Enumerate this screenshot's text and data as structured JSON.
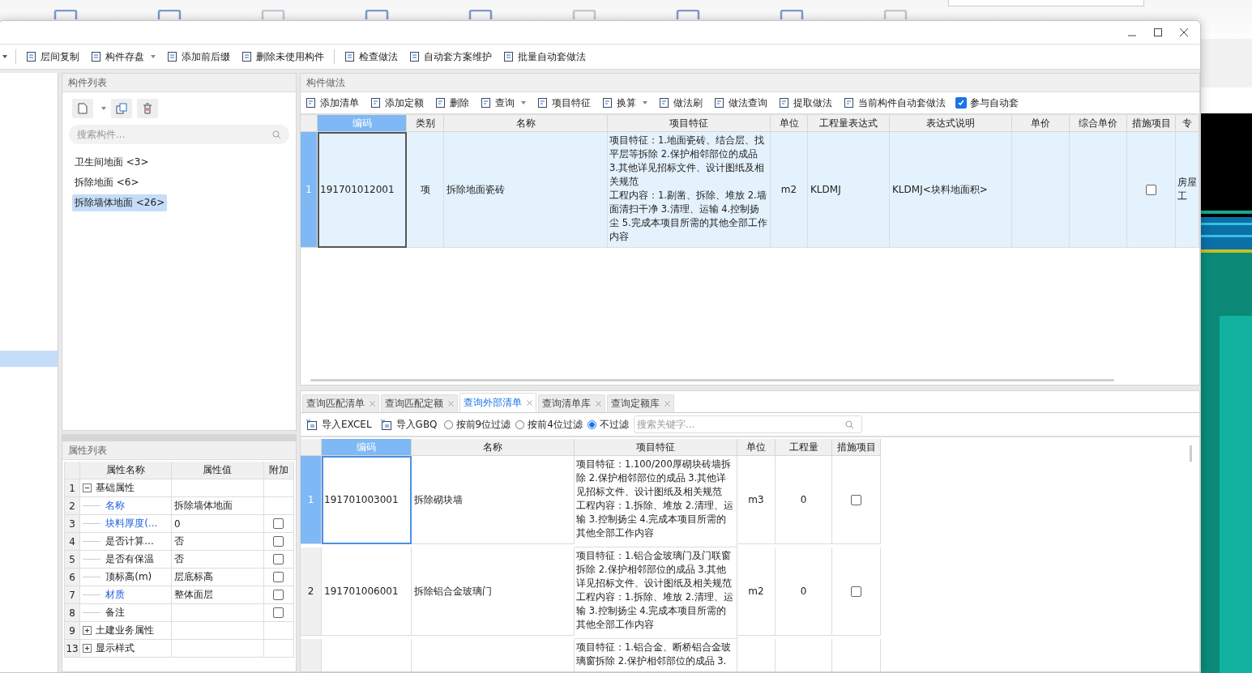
{
  "dialog_toolbar": [
    {
      "label": "层间复制",
      "dropdown": false
    },
    {
      "label": "构件存盘",
      "dropdown": true
    },
    {
      "label": "添加前后缀",
      "dropdown": false
    },
    {
      "label": "删除未使用构件",
      "dropdown": false
    },
    {
      "label": "检查做法",
      "dropdown": false
    },
    {
      "label": "自动套方案维护",
      "dropdown": false
    },
    {
      "label": "批量自动套做法",
      "dropdown": false
    }
  ],
  "component_list": {
    "title": "构件列表",
    "search": {
      "placeholder": "搜索构件..."
    },
    "items": [
      {
        "label": "卫生间地面 <3>",
        "selected": false
      },
      {
        "label": "拆除地面 <6>",
        "selected": false
      },
      {
        "label": "拆除墙体地面 <26>",
        "selected": true
      }
    ]
  },
  "property_list": {
    "title": "属性列表",
    "columns": [
      "属性名称",
      "属性值",
      "附加"
    ],
    "rows": [
      {
        "index": "1",
        "kind": "group",
        "expanded": true,
        "name": "基础属性"
      },
      {
        "index": "2",
        "kind": "property",
        "name": "名称",
        "value": "拆除墙体地面",
        "highlighted": true
      },
      {
        "index": "3",
        "kind": "property",
        "name": "块料厚度(...",
        "value": "0",
        "highlighted": true,
        "checked": false
      },
      {
        "index": "4",
        "kind": "property",
        "name": "是否计算...",
        "value": "否",
        "highlighted": false,
        "checked": false
      },
      {
        "index": "5",
        "kind": "property",
        "name": "是否有保温",
        "value": "否",
        "highlighted": false,
        "checked": false
      },
      {
        "index": "6",
        "kind": "property",
        "name": "顶标高(m)",
        "value": "层底标高",
        "highlighted": false,
        "checked": false
      },
      {
        "index": "7",
        "kind": "property",
        "name": "材质",
        "value": "整体面层",
        "highlighted": true,
        "checked": false
      },
      {
        "index": "8",
        "kind": "property",
        "name": "备注",
        "highlighted": false,
        "checked": false
      },
      {
        "index": "9",
        "kind": "group",
        "expanded": false,
        "name": "土建业务属性"
      },
      {
        "index": "13",
        "kind": "group",
        "expanded": false,
        "name": "显示样式"
      }
    ]
  },
  "method_panel": {
    "title": "构件做法",
    "toolbar": [
      {
        "label": "添加清单",
        "dropdown": false
      },
      {
        "label": "添加定额",
        "dropdown": false
      },
      {
        "label": "删除",
        "dropdown": false
      },
      {
        "label": "查询",
        "dropdown": true
      },
      {
        "label": "项目特征",
        "dropdown": false
      },
      {
        "label": "换算",
        "dropdown": true
      },
      {
        "label": "做法刷",
        "dropdown": false
      },
      {
        "label": "做法查询",
        "dropdown": false
      },
      {
        "label": "提取做法",
        "dropdown": false
      },
      {
        "label": "当前构件自动套做法",
        "dropdown": false
      }
    ],
    "auto_match": {
      "label": "参与自动套",
      "checked": true
    },
    "columns": [
      {
        "label": "编码",
        "selected": true
      },
      {
        "label": "类别",
        "selected": false
      },
      {
        "label": "名称",
        "selected": false
      },
      {
        "label": "项目特征",
        "selected": false
      },
      {
        "label": "单位",
        "selected": false
      },
      {
        "label": "工程量表达式",
        "selected": false
      },
      {
        "label": "表达式说明",
        "selected": false
      },
      {
        "label": "单价",
        "selected": false
      },
      {
        "label": "综合单价",
        "selected": false
      },
      {
        "label": "措施项目",
        "selected": false
      },
      {
        "label": "专",
        "selected": false
      }
    ],
    "rows": [
      {
        "index": "1",
        "selected": true,
        "code": "191701012001",
        "category": "项",
        "name": "拆除地面瓷砖",
        "feature": "项目特征：1.地面瓷砖、结合层、找平层等拆除 2.保护相邻部位的成品 3.其他详见招标文件、设计图纸及相关规范",
        "content": "工程内容：1.剔凿、拆除、堆放 2.墙面清扫干净 3.清理、运输 4.控制扬尘 5.完成本项目所需的其他全部工作内容",
        "unit": "m2",
        "expression": "KLDMJ",
        "expression_note": "KLDMJ<块料地面积>",
        "measure": false,
        "column_11": "房屋工"
      }
    ]
  },
  "query_tabs": [
    {
      "label": "查询匹配清单",
      "selected": false
    },
    {
      "label": "查询匹配定额",
      "selected": false
    },
    {
      "label": "查询外部清单",
      "selected": true
    },
    {
      "label": "查询清单库",
      "selected": false
    },
    {
      "label": "查询定额库",
      "selected": false
    }
  ],
  "query_toolbar": {
    "buttons": [
      "导入EXCEL",
      "导入GBQ"
    ],
    "filters": [
      {
        "label": "按前9位过滤",
        "selected": false
      },
      {
        "label": "按前4位过滤",
        "selected": false
      },
      {
        "label": "不过滤",
        "selected": true
      }
    ],
    "search": {
      "placeholder": "搜索关键字..."
    }
  },
  "query_table": {
    "columns": [
      {
        "label": "编码",
        "selected": true
      },
      {
        "label": "名称",
        "selected": false
      },
      {
        "label": "项目特征",
        "selected": false
      },
      {
        "label": "单位",
        "selected": false
      },
      {
        "label": "工程量",
        "selected": false
      },
      {
        "label": "措施项目",
        "selected": false
      }
    ],
    "rows": [
      {
        "index": "1",
        "selected": true,
        "code": "191701003001",
        "name": "拆除砌块墙",
        "feature": "项目特征：1.100/200厚砌块砖墙拆除 2.保护相邻部位的成品 3.其他详见招标文件、设计图纸及相关规范",
        "content": "工程内容：1.拆除、堆放 2.清理、运输 3.控制扬尘 4.完成本项目所需的其他全部工作内容",
        "unit": "m3",
        "quantity": "0",
        "measure": false
      },
      {
        "index": "2",
        "selected": false,
        "code": "191701006001",
        "name": "拆除铝合金玻璃门",
        "feature": "项目特征：1.铝合金玻璃门及门联窗拆除 2.保护相邻部位的成品 3.其他详见招标文件、设计图纸及相关规范",
        "content": "工程内容：1.拆除、堆放 2.清理、运输 3.控制扬尘 4.完成本项目所需的其他全部工作内容",
        "unit": "m2",
        "quantity": "0",
        "measure": false
      },
      {
        "selected": false,
        "feature": "项目特征：1.铝合金、断桥铝合金玻璃窗拆除 2.保护相邻部位的成品 3."
      }
    ]
  }
}
